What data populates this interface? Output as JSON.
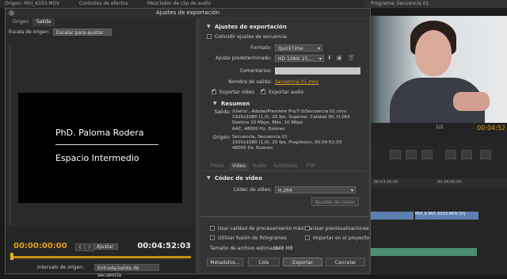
{
  "background": {
    "top_tab_left": "Origen: MVI_6333.MOV",
    "top_tab_mid": "Controles de efectos",
    "top_tab_mid2": "Mezclador de clip de audio",
    "program_tab": "Programa: Secuencia 01",
    "program_time": "00:04:52",
    "program_zoom": "1/2",
    "timeline_tc1": "00:03:00:00",
    "timeline_tc2": "00:04:00:00",
    "clip_label": "MVI_6333.MOV [V]",
    "clip_label2": "MVI_6"
  },
  "dialog": {
    "title": "Ajustes de exportación",
    "tabs": [
      {
        "label": "Origen",
        "active": false
      },
      {
        "label": "Salida",
        "active": true
      }
    ]
  },
  "left": {
    "scale_label": "Escala de origen:",
    "scale_value": "Escalar para ajustar",
    "preview_name": "PhD. Paloma Rodera",
    "preview_place": "Espacio Intermedio",
    "timecode_start": "00:00:00:00",
    "timecode_end": "00:04:52:03",
    "adjust_value": "Ajustar",
    "range_label": "Intervalo de origen:",
    "range_value": "Entrada/salida de secuencia",
    "mark_in_glyph": "{",
    "mark_out_glyph": "}"
  },
  "right": {
    "match_sequence_label": "Coincidir ajustes de secuencia",
    "export_settings_title": "Ajustes de exportación",
    "format_label": "Formato:",
    "format_value": "QuickTime",
    "preset_label": "Ajuste predeterminado:",
    "preset_value": "HD 1080i 25,...",
    "comments_label": "Comentarios:",
    "comments_value": "",
    "output_label": "Nombre de salida:",
    "output_value": "Secuencia 01.mov",
    "export_video_label": "Exportar vídeo",
    "export_audio_label": "Exportar audio",
    "summary_title": "Resumen",
    "output_summary_label": "Salida:",
    "output_summary_lines": "/Users/...Adobe/Premiere Pro/7.0/Secuencia 01.mov\n1920x1080 (1,0), 25 fps, Superior, Calidad 90, H.264\nDestino 10 Mbps, Máx. 10 Mbps\nAAC, 48000 Hz, Estéreo",
    "source_summary_label": "Origen:",
    "source_summary_lines": "Secuencia, Secuencia 01\n1920x1080 (1,0), 25 fps, Progresivo, 00:04:52:03\n48000 Hz, Estéreo",
    "panel_tabs": [
      {
        "label": "Filtros",
        "active": false
      },
      {
        "label": "Vídeo",
        "active": true
      },
      {
        "label": "Audio",
        "active": false
      },
      {
        "label": "Subtítulos",
        "active": false
      },
      {
        "label": "FTP",
        "active": false
      }
    ],
    "video_codec_title": "Códec de vídeo",
    "codec_label": "Códec de vídeo:",
    "codec_value": "H.264",
    "codec_settings_button": "Ajustes de códec",
    "max_quality_label": "Usar calidad de procesamiento máxima",
    "use_previews_label": "Usar previsualizaciones",
    "frame_blend_label": "Utilizar fusión de fotogramas",
    "import_project_label": "Importar en el proyecto",
    "filesize_label": "Tamaño de archivo estimado:",
    "filesize_value": "348 MB",
    "metadata_button": "Metadatos...",
    "queue_button": "Cola",
    "export_button": "Exportar",
    "cancel_button": "Cancelar",
    "match_sequence_checked": false,
    "export_video_checked": true,
    "export_audio_checked": true,
    "max_quality_checked": false,
    "use_previews_checked": false,
    "frame_blend_checked": false,
    "import_project_checked": false
  },
  "colors": {
    "accent_timecode": "#e0a020",
    "link": "#e0a020",
    "dialog_bg": "#3a3a3a"
  },
  "icons": [
    "chevron-down-icon",
    "save-preset-icon",
    "import-preset-icon",
    "delete-preset-icon",
    "disclosure-triangle-icon",
    "close-icon"
  ]
}
